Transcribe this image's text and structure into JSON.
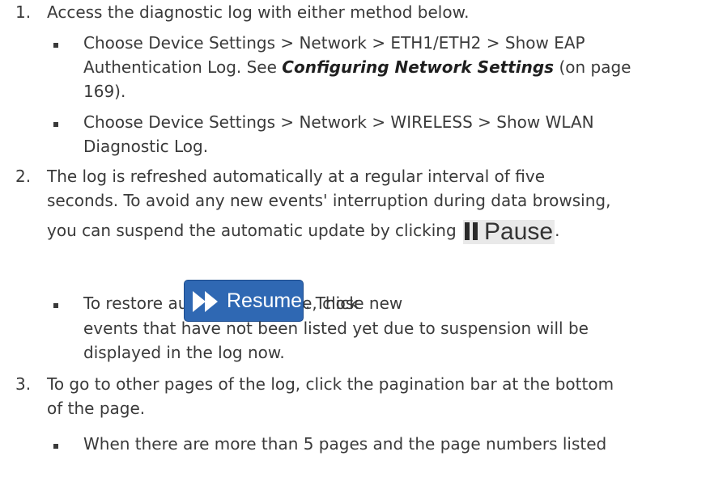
{
  "steps": [
    {
      "number": "1.",
      "lines": [
        "Access the diagnostic log with either method below."
      ],
      "bullets": [
        {
          "line1": "Choose Device Settings > Network > ETH1/ETH2 > Show EAP",
          "line2_pre": "Authentication Log. See ",
          "line2_link": "Configuring Network Settings",
          "line2_post": " (on page",
          "line3": "169)."
        },
        {
          "line1": "Choose Device Settings > Network > WIRELESS > Show WLAN",
          "line2": "Diagnostic Log."
        }
      ]
    },
    {
      "number": "2.",
      "line1": "The log is refreshed automatically at a regular interval of five",
      "line2": "seconds. To avoid any new events' interruption during data browsing,",
      "line3_pre": "you can suspend the automatic update by clicking",
      "line3_post": ".",
      "bullet": {
        "pre": "To restore automatic update, click",
        "post": ". Those new",
        "line2": "events that have not been listed yet due to suspension will be",
        "line3": "displayed in the log now."
      }
    },
    {
      "number": "3.",
      "line1": "To go to other pages of the log, click the pagination bar at the bottom",
      "line2": "of the page.",
      "bullet": {
        "line1": "When there are more than 5 pages and the page numbers listed"
      }
    }
  ],
  "buttons": {
    "pause_label": "Pause",
    "resume_label": "Resume"
  },
  "icons": {
    "pause": "pause-icon",
    "resume": "fast-forward-icon"
  }
}
